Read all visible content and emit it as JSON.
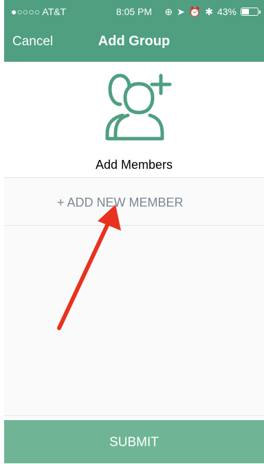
{
  "status_bar": {
    "carrier": "●○○○○ AT&T",
    "time": "8:05 PM",
    "battery": "43%"
  },
  "nav": {
    "cancel_label": "Cancel",
    "title": "Add Group"
  },
  "header": {
    "icon": "add-group-icon",
    "label": "Add Members"
  },
  "list": {
    "add_new_member_label": "+ ADD NEW MEMBER"
  },
  "footer": {
    "submit_label": "SUBMIT"
  },
  "colors": {
    "nav_bar": "#4f9f80",
    "submit_bar": "#6fb595",
    "icon_stroke": "#4f9f80",
    "arrow": "#e8321f"
  }
}
